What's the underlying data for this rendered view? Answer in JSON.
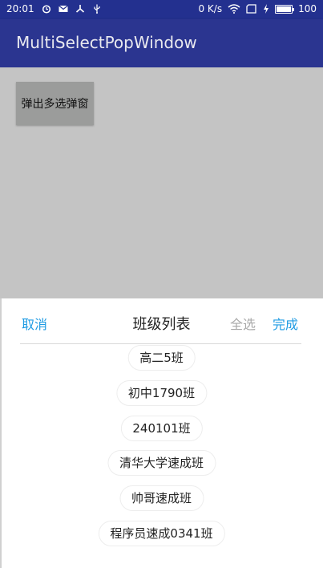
{
  "status_bar": {
    "time": "20:01",
    "network_speed": "0 K/s",
    "battery": "100",
    "battery_level": 1.0,
    "icons_left": [
      "alarm-icon",
      "mail-icon",
      "wind-icon",
      "usb-icon"
    ],
    "icons_right": [
      "wifi-icon",
      "sim-icon",
      "charging-icon",
      "battery-icon"
    ]
  },
  "app_bar": {
    "title": "MultiSelectPopWindow",
    "background": "#2b3590"
  },
  "main": {
    "open_button_label": "弹出多选弹窗"
  },
  "popup": {
    "cancel_label": "取消",
    "title": "班级列表",
    "select_all_label": "全选",
    "done_label": "完成",
    "accent_color": "#1e9be3",
    "items": [
      "高二5班",
      "初中1790班",
      "240101班",
      "清华大学速成班",
      "帅哥速成班",
      "程序员速成0341班"
    ]
  }
}
